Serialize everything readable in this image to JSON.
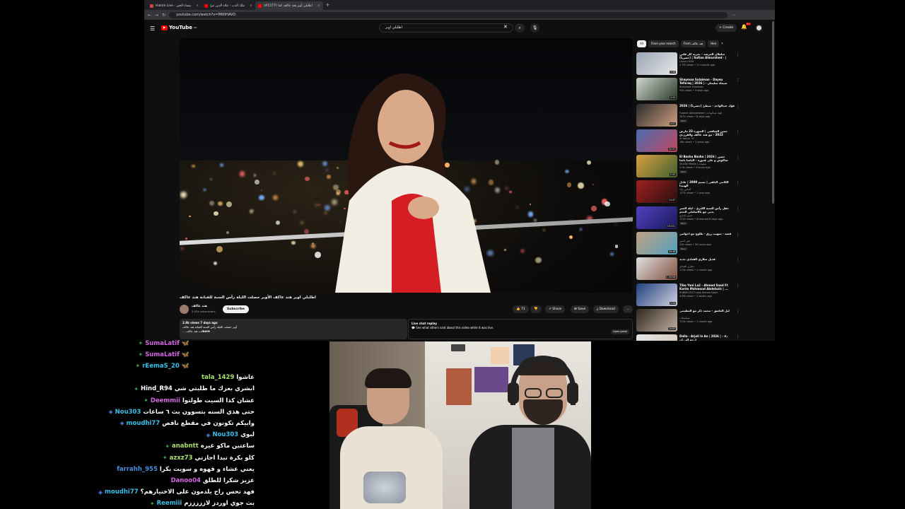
{
  "browser": {
    "tabs": [
      {
        "label": "Hakim Live - مساء الخير"
      },
      {
        "label": "ملك الدب - علاء الدين ميّ"
      },
      {
        "label": "(#1577) اطلبلي أوبر هند عاكف كما"
      }
    ],
    "new_tab": "+",
    "url": "youtube.com/watch?v=MWIHAVO"
  },
  "youtube": {
    "logo_text": "YouTube",
    "logo_sup": "SA",
    "search_query": "اطلبلي اوبر",
    "create_label": "+ Create",
    "notif_count": "9+",
    "video_title": "اطلبلي اوبر هند عاكف الأوبر حصلت الليلة رأس السنة للفنانة هند عاكف",
    "channel_name": "هند عاكف",
    "channel_subs": "3.03k subscribers",
    "subscribe_label": "Subscribe",
    "like_count": "71",
    "share_label": "Share",
    "save_label": "Save",
    "download_label": "Download",
    "more_label": "...",
    "desc_meta": "2.8k views  7 days ago",
    "desc_line1": "أوبر حصلت الليلة رأس السنة للفنانة هند عاكف",
    "desc_line2": "... هند عاكف",
    "desc_more": "...more",
    "chat_title": "Live chat replay",
    "chat_sub": "See what others said about this video while it was live.",
    "open_panel": "Open panel",
    "chips": [
      "All",
      "From your search",
      "From هند عاكف",
      "Hen"
    ],
    "recs": [
      {
        "title": "سلطان المرشد - بخرنه كار قلبي (حصرياً) | Sultan Almurshed - | 2025 ...",
        "channel": "Luxury KSA",
        "meta": "2.7M views • 11 months ago",
        "badge": "",
        "dur": "3:36",
        "colors": [
          "#9aa5b5",
          "#e8e8e8"
        ]
      },
      {
        "title": "Shaymaa Sulaiman - Dayeu Tefaraq | 2026 | شيماء سليمان - ضايع",
        "channel": "Shaymaa Sulaiman",
        "meta": "93k views • 9 days ago",
        "badge": "",
        "dur": "4:43",
        "colors": [
          "#cfd8cf",
          "#2a3a2a"
        ]
      },
      {
        "title": "فؤاد عبدالواحد - مبطيّ (حصرياً) | 2026",
        "channel": "Fuadah Abdulwahad | فؤاد عبدالواحد",
        "meta": "347k views • 6 days ago",
        "badge": "New",
        "dur": "4:51",
        "colors": [
          "#2b2b2b",
          "#d0a080"
        ]
      },
      {
        "title": "حسن الشافعي | السهرة 23 مارس 2022 - مع هند عاكف والفرزدي وباسكاشعيا من دبي",
        "channel": "Al Nahar TV",
        "meta": "18k views • 3 years ago",
        "badge": "",
        "dur": "32:21",
        "colors": [
          "#4a6ab0",
          "#c04a60"
        ]
      },
      {
        "title": "El Basha Basha | 2026 | حسن شاكوش و علي قدورة - الباشا باشا (كليب)",
        "channel": "Sha3bi Media | شعبيات",
        "meta": "2.3k views • 4 hours ago",
        "badge": "New",
        "dur": "2:42",
        "colors": [
          "#d9a040",
          "#406030"
        ]
      },
      {
        "title": "الكاتبي البلقي | نسيم 2000 | عادل الهبيدا",
        "channel": "آلماس رائد",
        "meta": "137k views • 1 year ago",
        "badge": "",
        "dur": "14:47",
        "colors": [
          "#a02020",
          "#2a1010"
        ]
      },
      {
        "title": "حفل رأس السنة الكبرى - ليلة العمر بدبي مع بالاساملي النجم",
        "channel": "حسن إنداري",
        "meta": "171k views • Streamed 6 days ago",
        "badge": "New",
        "dur": "3:54:51",
        "colors": [
          "#5040c0",
          "#1a1a5a"
        ]
      },
      {
        "title": "قصة - سهيب رزق - طلوع مع اجوامي",
        "channel": "علي أدمين",
        "meta": "23k views • 30 hours ago",
        "badge": "New",
        "dur": "40:46",
        "colors": [
          "#c0a080",
          "#50a0c0"
        ]
      },
      {
        "title": "قديل سلاري القيادي جديد",
        "channel": "سلاري القيادي",
        "meta": "173k views • 1 month ago",
        "badge": "",
        "dur": "1:00:58",
        "colors": [
          "#e0e0e0",
          "#805040"
        ]
      },
      {
        "title": "Tiba Yani La2 - Ahmed Saad Ft Karim Mahmoud Abdelaziz | ...",
        "channel": "PUBIKO ELTO and Ahmed Saad",
        "meta": "4.6M views • 3 weeks ago",
        "badge": "",
        "dur": "2:34",
        "colors": [
          "#204080",
          "#d0d0e0"
        ]
      },
      {
        "title": "ليل العاشق - محمد ذكر مع العظيمى",
        "channel": "مسلسلات",
        "meta": "702k views • 1 month ago",
        "badge": "",
        "dur": "20:03",
        "colors": [
          "#302820",
          "#c0b0a0"
        ]
      },
      {
        "title": "Dalla - Arjoli Is An | 2026 | دلا - ارجع الى ان",
        "channel": "",
        "meta": "",
        "badge": "",
        "dur": "",
        "colors": [
          "#e8e8e8",
          "#d0c0b0"
        ]
      }
    ]
  },
  "chat": {
    "messages": [
      {
        "user": "SumaLatif",
        "color": "#d46ae0",
        "badge": "green",
        "text": ""
      },
      {
        "user": "SumaLatif",
        "color": "#d46ae0",
        "badge": "green",
        "text": ""
      },
      {
        "user": "rEemaS_20",
        "color": "#3ac0e8",
        "badge": "green",
        "text": ""
      },
      {
        "user": "tala_1429",
        "color": "#a8e070",
        "badge": "",
        "text": "عاشوا"
      },
      {
        "user": "Hind_R94",
        "color": "#ffffff",
        "badge": "green",
        "text": "ابشري بعزك ما طلبتي شي"
      },
      {
        "user": "Deemmii",
        "color": "#d46ae0",
        "badge": "green",
        "text": "عشان كذا السيت طولتوا"
      },
      {
        "user": "Nou303",
        "color": "#3ac0e8",
        "badge": "blue",
        "text": "حتى هذي السنه بتسوون بث ٦ ساعات"
      },
      {
        "user": "moudhi77",
        "color": "#3ac0e8",
        "badge": "blue",
        "text": "وابيكم تكونون في مقطع ناقص"
      },
      {
        "user": "Nou303",
        "color": "#3ac0e8",
        "badge": "blue",
        "text": "لبوي"
      },
      {
        "user": "anabntt",
        "color": "#a8e070",
        "badge": "green",
        "text": "ساعتين ماكو غيره"
      },
      {
        "user": "azxz73",
        "color": "#a8e070",
        "badge": "green",
        "text": "كلو بكرة تبدا اجازتي"
      },
      {
        "user": "farrahh_955",
        "color": "#4a90e2",
        "badge": "",
        "text": "يعني عشاء و قهوه و سويت بكرا"
      },
      {
        "user": "Danoo04",
        "color": "#d46ae0",
        "badge": "",
        "text": "عزيز شكرا للطلق"
      },
      {
        "user": "moudhi77",
        "color": "#3ac0e8",
        "badge": "blue",
        "text": "فهد تحس راح يلدمون على الاختيارهم؟"
      },
      {
        "user": "Reemiii",
        "color": "#3ac0e8",
        "badge": "green",
        "text": "بث جوي اوردز لازززززم"
      }
    ]
  }
}
